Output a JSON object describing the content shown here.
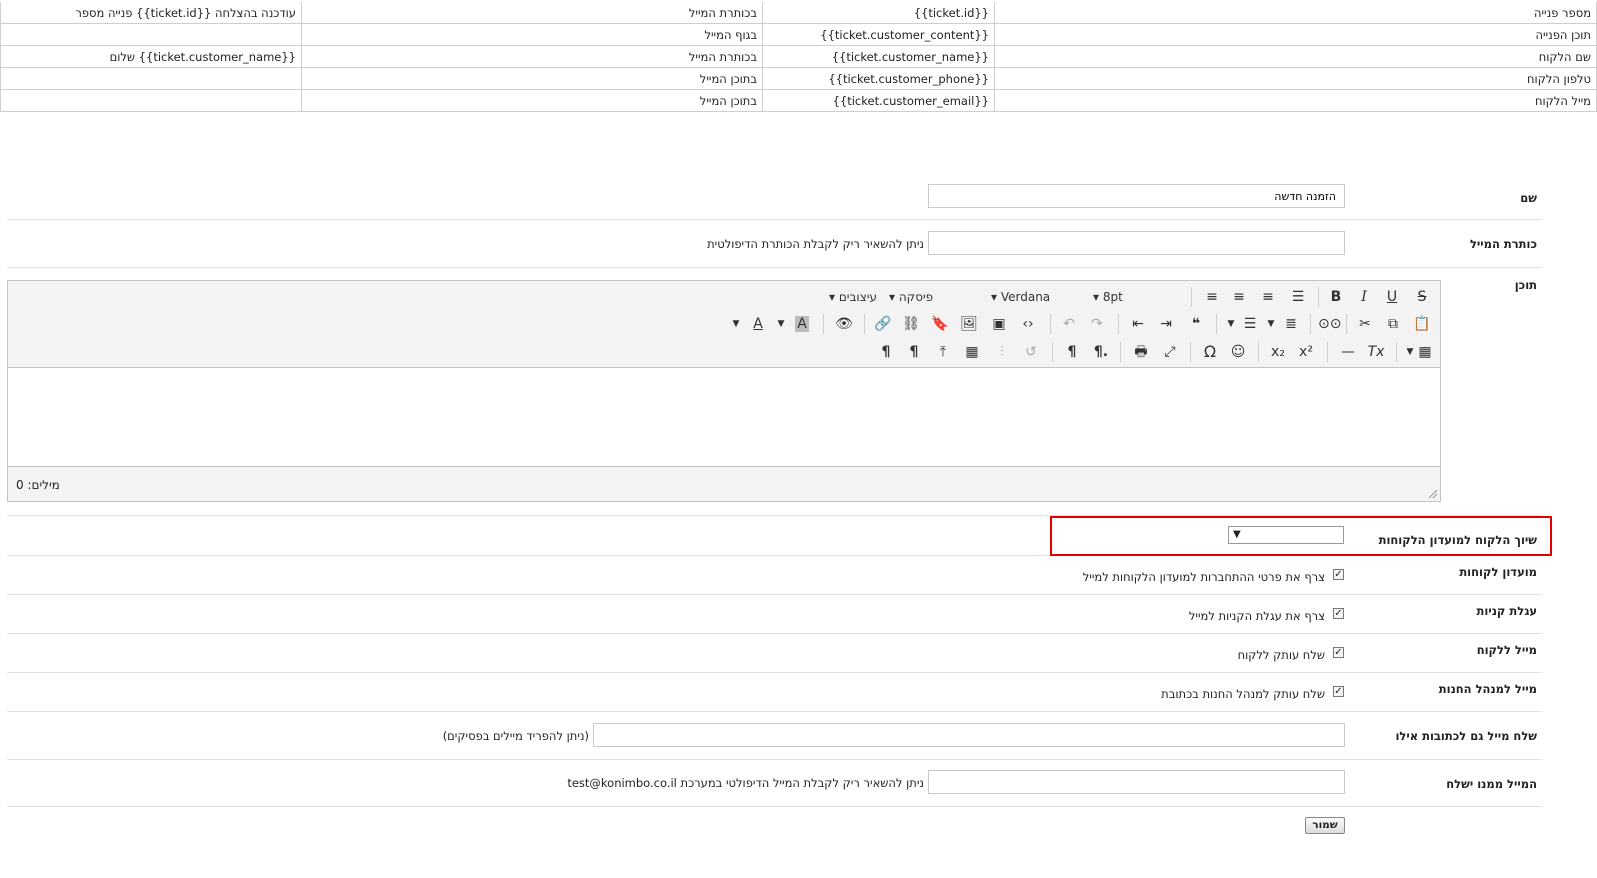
{
  "vars_table": {
    "rows": [
      {
        "label": "מספר פנייה",
        "var": "{{ticket.id}}",
        "where": "בכותרת המייל",
        "example": "פנייה מספר {{ticket.id}} עודכנה בהצלחה"
      },
      {
        "label": "תוכן הפנייה",
        "var": "{{ticket.customer_content}}",
        "where": "בגוף המייל",
        "example": ""
      },
      {
        "label": "שם הלקוח",
        "var": "{{ticket.customer_name}}",
        "where": "בכותרת המייל",
        "example": "שלום {{ticket.customer_name}}"
      },
      {
        "label": "טלפון הלקוח",
        "var": "{{ticket.customer_phone}}",
        "where": "בתוכן המייל",
        "example": ""
      },
      {
        "label": "מייל הלקוח",
        "var": "{{ticket.customer_email}}",
        "where": "בתוכן המייל",
        "example": ""
      }
    ]
  },
  "form": {
    "name_label": "שם",
    "name_value": "הזמנה חדשה",
    "subject_label": "כותרת המייל",
    "subject_value": "",
    "subject_hint": "ניתן להשאיר ריק לקבלת הכותרת הדיפולטית",
    "content_label": "תוכן",
    "club_assign_label": "שיוך הלקוח למועדון הלקוחות",
    "club_assign_value": "▼",
    "club_label": "מועדון לקוחות",
    "club_text": "צרף את פרטי ההתחברות למועדון הלקוחות למייל",
    "cart_label": "עגלת קניות",
    "cart_text": "צרף את עגלת הקניות למייל",
    "to_customer_label": "מייל ללקוח",
    "to_customer_text": "שלח עותק ללקוח",
    "to_manager_label": "מייל למנהל החנות",
    "to_manager_text": "שלח עותק למנהל החנות בכתובת",
    "extra_label": "שלח מייל גם לכתובות אילו",
    "extra_value": "",
    "extra_hint": "(ניתן להפריד מיילים בפסיקים)",
    "from_label": "המייל ממנו ישלח",
    "from_value": "",
    "from_hint": "ניתן להשאיר ריק לקבלת המייל הדיפולטי במערכת test@konimbo.co.il",
    "save_label": "שמור"
  },
  "editor": {
    "font_size": "8pt",
    "font_name": "Verdana",
    "paragraph": "פיסקה",
    "styles": "עיצובים",
    "word_count": "מילים: 0"
  },
  "colors": {
    "highlight": "#e00000",
    "border": "#c4c4c4"
  }
}
